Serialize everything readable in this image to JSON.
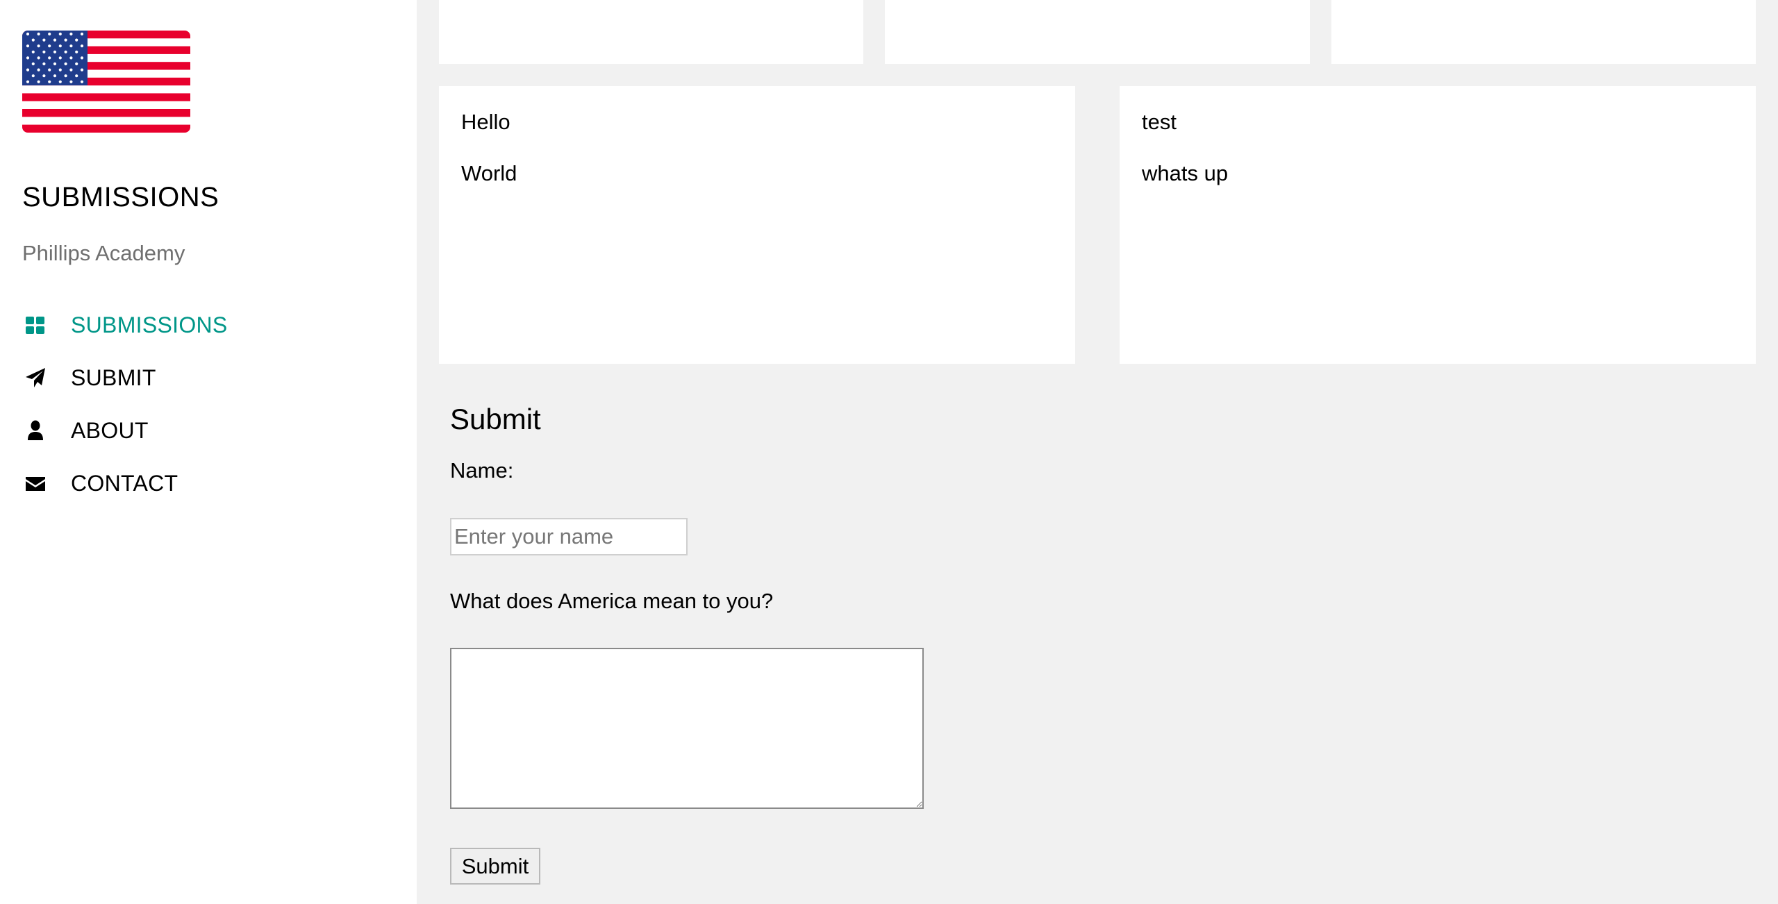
{
  "sidebar": {
    "title": "SUBMISSIONS",
    "subtitle": "Phillips Academy",
    "nav": [
      {
        "label": "SUBMISSIONS",
        "icon": "grid-icon",
        "active": true
      },
      {
        "label": "SUBMIT",
        "icon": "paper-plane-icon",
        "active": false
      },
      {
        "label": "ABOUT",
        "icon": "user-icon",
        "active": false
      },
      {
        "label": "CONTACT",
        "icon": "envelope-icon",
        "active": false
      }
    ]
  },
  "submissions": [
    {
      "name": "Hello",
      "text": "World"
    },
    {
      "name": "test",
      "text": "whats up"
    }
  ],
  "form": {
    "heading": "Submit",
    "name_label": "Name:",
    "name_placeholder": "Enter your name",
    "name_value": "",
    "question_label": "What does America mean to you?",
    "answer_value": "",
    "submit_label": "Submit"
  },
  "colors": {
    "accent": "#009688",
    "flag_red": "#e8002d",
    "flag_blue": "#1f3c8c"
  }
}
